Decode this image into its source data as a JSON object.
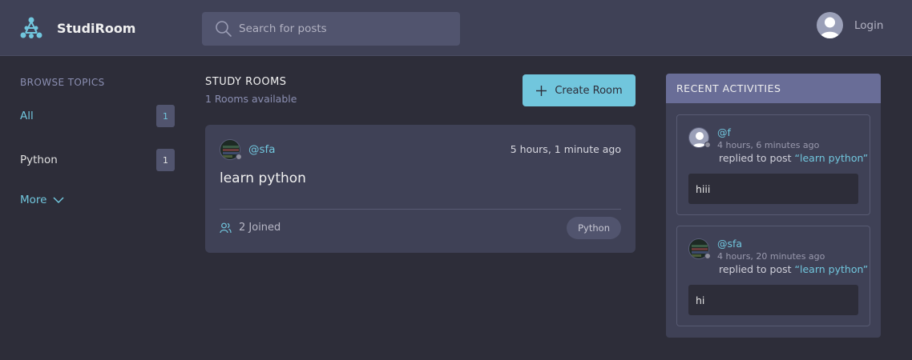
{
  "app": {
    "name": "StudiRoom"
  },
  "search": {
    "placeholder": "Search for posts"
  },
  "header": {
    "login_label": "Login"
  },
  "sidebar": {
    "title": "BROWSE TOPICS",
    "topics": [
      {
        "name": "All",
        "count": "1"
      },
      {
        "name": "Python",
        "count": "1"
      }
    ],
    "more_label": "More"
  },
  "main": {
    "title": "STUDY ROOMS",
    "subtitle": "1 Rooms available",
    "create_label": "Create Room",
    "rooms": [
      {
        "host": "@sfa",
        "time": "5 hours, 1 minute ago",
        "name": "learn python",
        "joined": "2 Joined",
        "topic": "Python"
      }
    ]
  },
  "activities": {
    "title": "RECENT ACTIVITIES",
    "items": [
      {
        "user": "@f",
        "time": "4 hours, 6 minutes ago",
        "action": "replied to post",
        "post": "“learn python”",
        "message": "hiii"
      },
      {
        "user": "@sfa",
        "time": "4 hours, 20 minutes ago",
        "action": "replied to post",
        "post": "“learn python”",
        "message": "hi"
      }
    ]
  },
  "colors": {
    "background": "#2d2d39",
    "header": "#3f4156",
    "card": "#3f4156",
    "accent": "#71c6dd",
    "activity_header": "#696d97",
    "muted": "#8b8fb2"
  }
}
